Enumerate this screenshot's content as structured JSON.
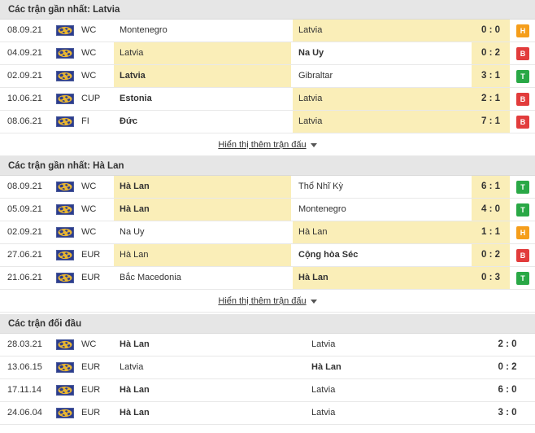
{
  "sections": [
    {
      "title": "Các trận gần nhất: Latvia",
      "more_label": "Hiển thị thêm trận đấu",
      "matches": [
        {
          "date": "08.09.21",
          "comp": "WC",
          "home": "Montenegro",
          "away": "Latvia",
          "score": "0 : 0",
          "result": "H",
          "highlight": "away",
          "bold": "none"
        },
        {
          "date": "04.09.21",
          "comp": "WC",
          "home": "Latvia",
          "away": "Na Uy",
          "score": "0 : 2",
          "result": "B",
          "highlight": "home",
          "bold": "away"
        },
        {
          "date": "02.09.21",
          "comp": "WC",
          "home": "Latvia",
          "away": "Gibraltar",
          "score": "3 : 1",
          "result": "T",
          "highlight": "home",
          "bold": "home"
        },
        {
          "date": "10.06.21",
          "comp": "CUP",
          "home": "Estonia",
          "away": "Latvia",
          "score": "2 : 1",
          "result": "B",
          "highlight": "away",
          "bold": "home"
        },
        {
          "date": "08.06.21",
          "comp": "FI",
          "home": "Đức",
          "away": "Latvia",
          "score": "7 : 1",
          "result": "B",
          "highlight": "away",
          "bold": "home"
        }
      ]
    },
    {
      "title": "Các trận gần nhất: Hà Lan",
      "more_label": "Hiển thị thêm trận đấu",
      "matches": [
        {
          "date": "08.09.21",
          "comp": "WC",
          "home": "Hà Lan",
          "away": "Thổ Nhĩ Kỳ",
          "score": "6 : 1",
          "result": "T",
          "highlight": "home",
          "bold": "home"
        },
        {
          "date": "05.09.21",
          "comp": "WC",
          "home": "Hà Lan",
          "away": "Montenegro",
          "score": "4 : 0",
          "result": "T",
          "highlight": "home",
          "bold": "home"
        },
        {
          "date": "02.09.21",
          "comp": "WC",
          "home": "Na Uy",
          "away": "Hà Lan",
          "score": "1 : 1",
          "result": "H",
          "highlight": "away",
          "bold": "none"
        },
        {
          "date": "27.06.21",
          "comp": "EUR",
          "home": "Hà Lan",
          "away": "Cộng hòa Séc",
          "score": "0 : 2",
          "result": "B",
          "highlight": "home",
          "bold": "away"
        },
        {
          "date": "21.06.21",
          "comp": "EUR",
          "home": "Bắc Macedonia",
          "away": "Hà Lan",
          "score": "0 : 3",
          "result": "T",
          "highlight": "away",
          "bold": "away"
        }
      ]
    }
  ],
  "h2h": {
    "title": "Các trận đối đầu",
    "matches": [
      {
        "date": "28.03.21",
        "comp": "WC",
        "home": "Hà Lan",
        "away": "Latvia",
        "score": "2 : 0",
        "bold": "home"
      },
      {
        "date": "13.06.15",
        "comp": "EUR",
        "home": "Latvia",
        "away": "Hà Lan",
        "score": "0 : 2",
        "bold": "away"
      },
      {
        "date": "17.11.14",
        "comp": "EUR",
        "home": "Hà Lan",
        "away": "Latvia",
        "score": "6 : 0",
        "bold": "home"
      },
      {
        "date": "24.06.04",
        "comp": "EUR",
        "home": "Hà Lan",
        "away": "Latvia",
        "score": "3 : 0",
        "bold": "home"
      }
    ]
  },
  "colors": {
    "highlight": "#faeeb8",
    "win": "#29a846",
    "draw": "#f59e1b",
    "loss": "#e23c3c",
    "header_bg": "#e6e6e6"
  },
  "icons": {
    "competition_flag": "world-flag-icon",
    "more_caret": "caret-down-icon"
  }
}
